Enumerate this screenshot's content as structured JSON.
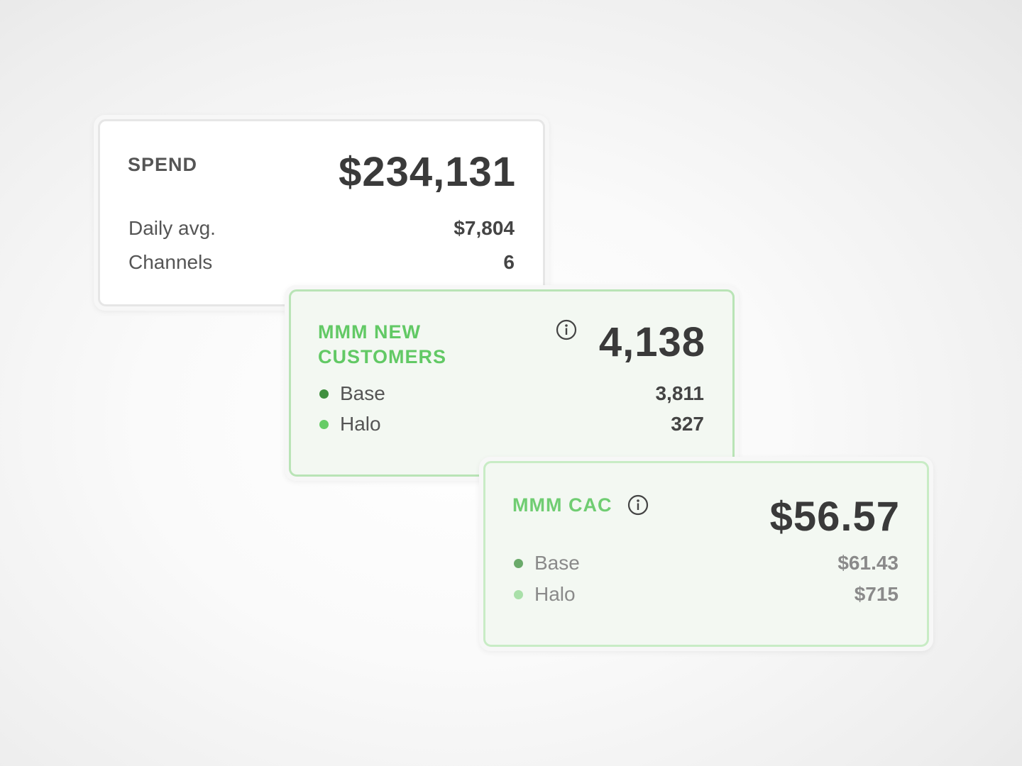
{
  "spend_card": {
    "title": "SPEND",
    "total": "$234,131",
    "rows": [
      {
        "label": "Daily avg.",
        "value": "$7,804"
      },
      {
        "label": "Channels",
        "value": "6"
      }
    ]
  },
  "customers_card": {
    "title_line1": "MMM NEW",
    "title_line2": "CUSTOMERS",
    "icon": "info-icon",
    "total": "4,138",
    "rows": [
      {
        "label": "Base",
        "value": "3,811",
        "dot_color": "#3f8f3f"
      },
      {
        "label": "Halo",
        "value": "327",
        "dot_color": "#66cc66"
      }
    ]
  },
  "cac_card": {
    "title": "MMM CAC",
    "icon": "info-icon",
    "total": "$56.57",
    "rows": [
      {
        "label": "Base",
        "value": "$61.43",
        "dot_color": "#6aaa6a"
      },
      {
        "label": "Halo",
        "value": "$715",
        "dot_color": "#a9e0a9"
      }
    ]
  },
  "colors": {
    "accent_green": "#62c965",
    "card_border_green": "#b9e4b6",
    "text_dark": "#3a3a3a"
  }
}
